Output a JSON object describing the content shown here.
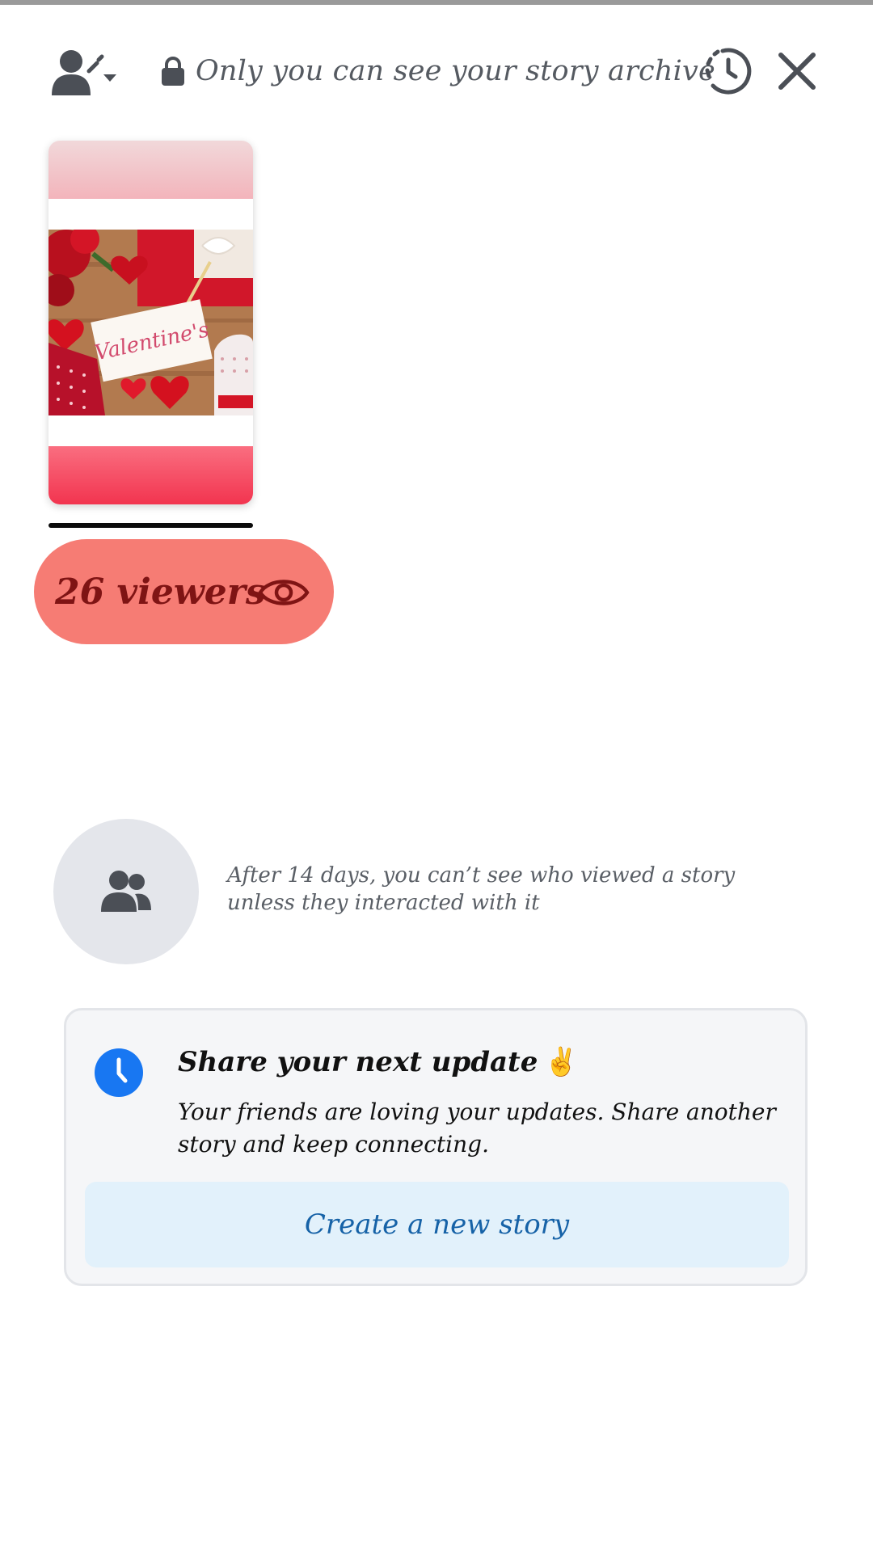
{
  "header": {
    "privacy_icon": "person-privacy-dropdown-icon",
    "lock_icon": "lock-icon",
    "archive_notice": "Only you can see your story archive",
    "history_icon": "story-history-icon",
    "close_icon": "close-icon"
  },
  "story": {
    "thumbnail_icon": "valentines-day-photo",
    "viewers_label": "26 viewers",
    "viewers_icon": "eye-icon"
  },
  "info": {
    "icon": "friends-icon",
    "text": "After 14 days, you can’t see who viewed a story unless they interacted with it"
  },
  "update_card": {
    "icon": "clock-icon",
    "title": "Share your next update",
    "title_emoji": "✌️",
    "body": "Your friends are loving your updates. Share another story and keep connecting.",
    "button_label": "Create a new story"
  },
  "colors": {
    "viewers_pill_bg": "#f67c74",
    "viewers_text": "#7f1414",
    "accent_blue": "#1877f2",
    "button_bg": "#e2f1fb",
    "button_text": "#1662a7"
  }
}
